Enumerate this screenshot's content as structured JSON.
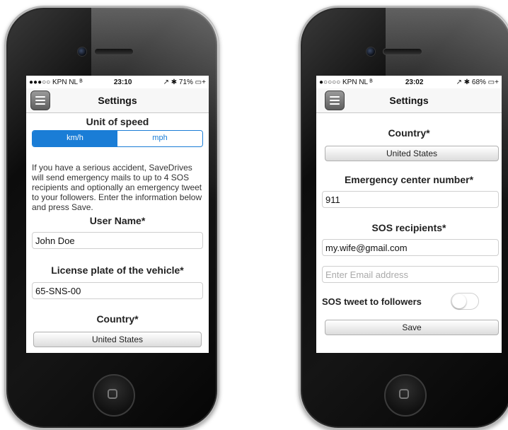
{
  "left_phone": {
    "status": {
      "carrier": "●●●○○ KPN NL ᴮ",
      "time": "23:10",
      "battery": "↗ ✱ 71% ▭+"
    },
    "nav_title": "Settings",
    "unit_label": "Unit of speed",
    "unit_options": [
      "km/h",
      "mph"
    ],
    "unit_selected": "km/h",
    "info_text": "If you have a serious accident, SaveDrives will send emergency mails to up to 4 SOS recipients and optionally an emergency tweet to your followers. Enter the information below and press Save.",
    "user_name_label": "User Name*",
    "user_name_value": "John Doe",
    "plate_label": "License plate of the vehicle*",
    "plate_value": "65-SNS-00",
    "country_label": "Country*",
    "country_value": "United States"
  },
  "right_phone": {
    "status": {
      "carrier": "●○○○○ KPN NL ᴮ",
      "time": "23:02",
      "battery": "↗ ✱ 68% ▭+"
    },
    "nav_title": "Settings",
    "country_label": "Country*",
    "country_value": "United States",
    "emergency_label": "Emergency center number*",
    "emergency_value": "911",
    "sos_label": "SOS recipients*",
    "sos_email_1": "my.wife@gmail.com",
    "sos_email_placeholder": "Enter Email address",
    "tweet_label": "SOS tweet to followers",
    "tweet_enabled": false,
    "save_label": "Save"
  }
}
